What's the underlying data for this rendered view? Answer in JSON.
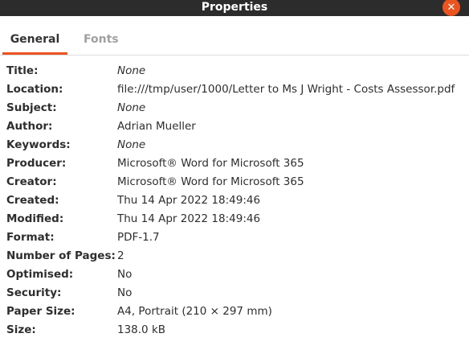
{
  "window": {
    "title": "Properties",
    "close_icon": "close-icon",
    "close_glyph": "✕"
  },
  "tabs": [
    {
      "label": "General",
      "active": true
    },
    {
      "label": "Fonts",
      "active": false
    }
  ],
  "properties": [
    {
      "label": "Title:",
      "value": "None",
      "italic": true
    },
    {
      "label": "Location:",
      "value": "file:///tmp/user/1000/Letter to Ms J Wright - Costs Assessor.pdf",
      "italic": false
    },
    {
      "label": "Subject:",
      "value": "None",
      "italic": true
    },
    {
      "label": "Author:",
      "value": "Adrian Mueller",
      "italic": false
    },
    {
      "label": "Keywords:",
      "value": "None",
      "italic": true
    },
    {
      "label": "Producer:",
      "value": "Microsoft® Word for Microsoft 365",
      "italic": false
    },
    {
      "label": "Creator:",
      "value": "Microsoft® Word for Microsoft 365",
      "italic": false
    },
    {
      "label": "Created:",
      "value": "Thu 14 Apr 2022 18:49:46",
      "italic": false
    },
    {
      "label": "Modified:",
      "value": "Thu 14 Apr 2022 18:49:46",
      "italic": false
    },
    {
      "label": "Format:",
      "value": "PDF-1.7",
      "italic": false
    },
    {
      "label": "Number of Pages:",
      "value": "2",
      "italic": false
    },
    {
      "label": "Optimised:",
      "value": "No",
      "italic": false
    },
    {
      "label": "Security:",
      "value": "No",
      "italic": false
    },
    {
      "label": "Paper Size:",
      "value": "A4, Portrait (210 × 297 mm)",
      "italic": false
    },
    {
      "label": "Size:",
      "value": "138.0 kB",
      "italic": false
    }
  ],
  "colors": {
    "accent": "#e95420",
    "titlebar": "#2c2c2c"
  }
}
